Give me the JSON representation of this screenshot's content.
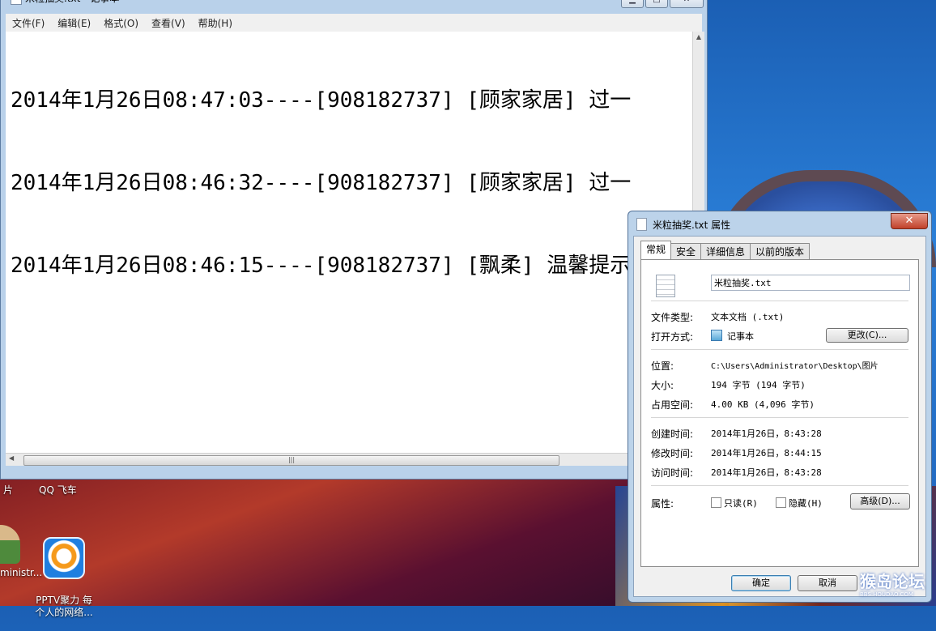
{
  "notepad": {
    "title": "米粒抽奖.txt - 记事本",
    "menu": [
      "文件(F)",
      "编辑(E)",
      "格式(O)",
      "查看(V)",
      "帮助(H)"
    ],
    "lines": [
      "2014年1月26日08:47:03----[908182737] [顾家家居] 过一",
      "2014年1月26日08:46:32----[908182737] [顾家家居] 过一",
      "2014年1月26日08:46:15----[908182737] [飘柔] 温馨提示"
    ]
  },
  "desktop": {
    "icons": [
      {
        "label": "PPTV聚力 每\n个人的网络...",
        "icon": "pptv-icon"
      },
      {
        "label": "ministr...",
        "icon": "user-icon"
      }
    ],
    "partial_labels": [
      "QQ 飞车",
      "片"
    ]
  },
  "properties": {
    "title": "米粒抽奖.txt 属性",
    "tabs": [
      "常规",
      "安全",
      "详细信息",
      "以前的版本"
    ],
    "active_tab": "常规",
    "filename": "米粒抽奖.txt",
    "file_type_label": "文件类型:",
    "file_type_value": "文本文档 (.txt)",
    "open_with_label": "打开方式:",
    "open_with_value": "记事本",
    "change_button": "更改(C)...",
    "location_label": "位置:",
    "location_value": "C:\\Users\\Administrator\\Desktop\\图片",
    "size_label": "大小:",
    "size_value": "194 字节 (194 字节)",
    "size_on_disk_label": "占用空间:",
    "size_on_disk_value": "4.00 KB (4,096 字节)",
    "created_label": "创建时间:",
    "created_value": "2014年1月26日，8:43:28",
    "modified_label": "修改时间:",
    "modified_value": "2014年1月26日，8:44:15",
    "accessed_label": "访问时间:",
    "accessed_value": "2014年1月26日，8:43:28",
    "attributes_label": "属性:",
    "readonly_label": "只读(R)",
    "hidden_label": "隐藏(H)",
    "advanced_button": "高级(D)...",
    "ok_button": "确定",
    "cancel_button": "取消"
  },
  "watermark": {
    "text": "猴岛论坛",
    "url": "BBS.HOUDAO.COM"
  }
}
